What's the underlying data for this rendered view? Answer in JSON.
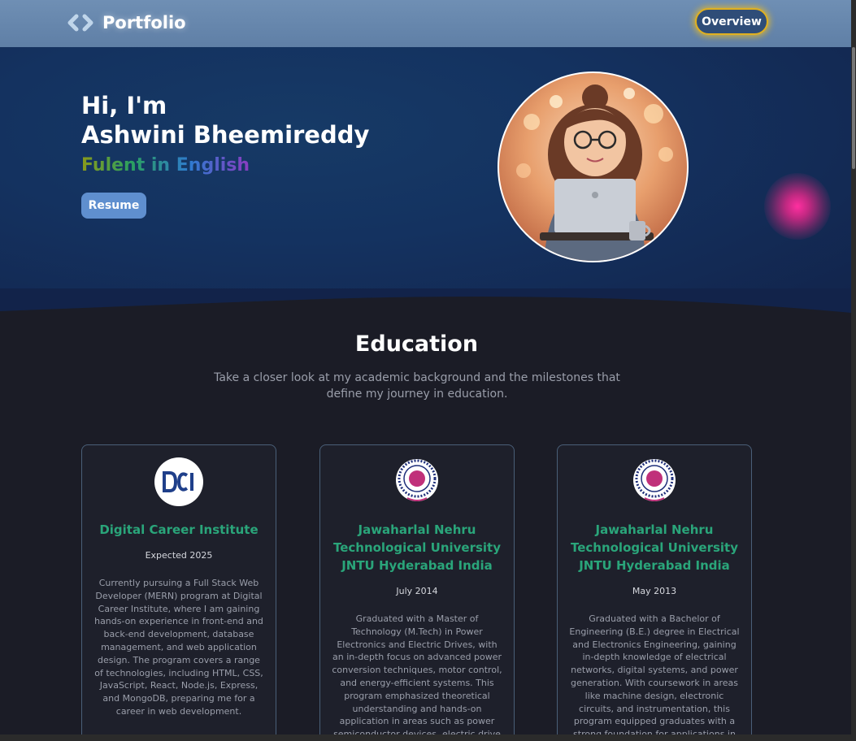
{
  "header": {
    "brand": "Portfolio",
    "brand_icon": "code-brackets-icon",
    "nav_button": "Overview"
  },
  "hero": {
    "greeting": "Hi, I'm",
    "name": "Ashwini Bheemireddy",
    "tagline": "Fulent in English",
    "resume_button": "Resume"
  },
  "education": {
    "title": "Education",
    "subtitle": "Take a closer look at my academic background and the milestones that define my journey in education.",
    "cards": [
      {
        "name": "Digital Career Institute",
        "date": "Expected 2025",
        "description": "Currently pursuing a Full Stack Web Developer (MERN) program at Digital Career Institute, where I am gaining hands-on experience in front-end and back-end development, database management, and web application design. The program covers a range of technologies, including HTML, CSS, JavaScript, React, Node.js, Express, and MongoDB, preparing me for a career in web development."
      },
      {
        "name": "Jawaharlal Nehru Technological University JNTU Hyderabad India",
        "date": "July 2014",
        "description": "Graduated with a Master of Technology (M.Tech) in Power Electronics and Electric Drives, with an in-depth focus on advanced power conversion techniques, motor control, and energy-efficient systems. This program emphasized theoretical understanding and hands-on application in areas such as power semiconductor devices, electric drive"
      },
      {
        "name": "Jawaharlal Nehru Technological University JNTU Hyderabad India",
        "date": "May 2013",
        "description": "Graduated with a Bachelor of Engineering (B.E.) degree in Electrical and Electronics Engineering, gaining in-depth knowledge of electrical networks, digital systems, and power generation. With coursework in areas like machine design, electronic circuits, and instrumentation, this program equipped graduates with a strong foundation for applications in"
      }
    ]
  },
  "colors": {
    "header_bg": "#6f8fb4",
    "hero_bg": "#143260",
    "page_bg": "#1b1c26",
    "accent_green": "#2aa57a",
    "nav_glow": "#e0b020",
    "resume_bg": "#5f8fcf"
  }
}
